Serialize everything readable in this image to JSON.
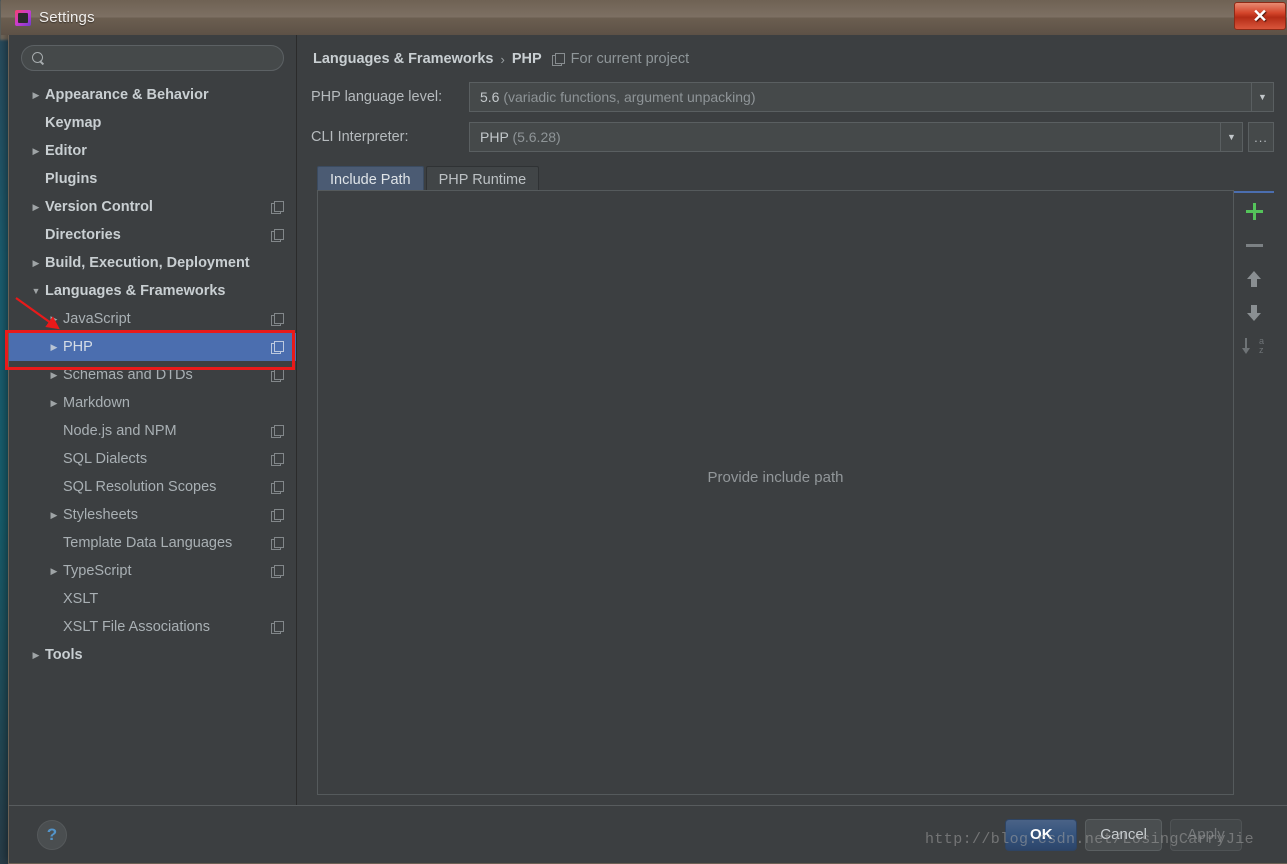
{
  "window": {
    "title": "Settings",
    "app_icon": "phpstorm-icon",
    "close_label": "✕"
  },
  "search": {
    "value": "",
    "placeholder": "",
    "icon": "search-icon"
  },
  "sidebar": {
    "items": [
      {
        "label": "Appearance & Behavior",
        "level": 0,
        "arrow": "▶",
        "badge": false,
        "selected": false
      },
      {
        "label": "Keymap",
        "level": 0,
        "arrow": "",
        "badge": false,
        "selected": false
      },
      {
        "label": "Editor",
        "level": 0,
        "arrow": "▶",
        "badge": false,
        "selected": false
      },
      {
        "label": "Plugins",
        "level": 0,
        "arrow": "",
        "badge": false,
        "selected": false
      },
      {
        "label": "Version Control",
        "level": 0,
        "arrow": "▶",
        "badge": true,
        "selected": false
      },
      {
        "label": "Directories",
        "level": 0,
        "arrow": "",
        "badge": true,
        "selected": false
      },
      {
        "label": "Build, Execution, Deployment",
        "level": 0,
        "arrow": "▶",
        "badge": false,
        "selected": false
      },
      {
        "label": "Languages & Frameworks",
        "level": 0,
        "arrow": "▼",
        "badge": false,
        "selected": false
      },
      {
        "label": "JavaScript",
        "level": 1,
        "arrow": "▶",
        "badge": true,
        "selected": false
      },
      {
        "label": "PHP",
        "level": 1,
        "arrow": "▶",
        "badge": true,
        "selected": true
      },
      {
        "label": "Schemas and DTDs",
        "level": 1,
        "arrow": "▶",
        "badge": true,
        "selected": false
      },
      {
        "label": "Markdown",
        "level": 1,
        "arrow": "▶",
        "badge": false,
        "selected": false
      },
      {
        "label": "Node.js and NPM",
        "level": 1,
        "arrow": "",
        "badge": true,
        "selected": false
      },
      {
        "label": "SQL Dialects",
        "level": 1,
        "arrow": "",
        "badge": true,
        "selected": false
      },
      {
        "label": "SQL Resolution Scopes",
        "level": 1,
        "arrow": "",
        "badge": true,
        "selected": false
      },
      {
        "label": "Stylesheets",
        "level": 1,
        "arrow": "▶",
        "badge": true,
        "selected": false
      },
      {
        "label": "Template Data Languages",
        "level": 1,
        "arrow": "",
        "badge": true,
        "selected": false
      },
      {
        "label": "TypeScript",
        "level": 1,
        "arrow": "▶",
        "badge": true,
        "selected": false
      },
      {
        "label": "XSLT",
        "level": 1,
        "arrow": "",
        "badge": false,
        "selected": false
      },
      {
        "label": "XSLT File Associations",
        "level": 1,
        "arrow": "",
        "badge": true,
        "selected": false
      },
      {
        "label": "Tools",
        "level": 0,
        "arrow": "▶",
        "badge": false,
        "selected": false
      }
    ]
  },
  "breadcrumb": {
    "parent": "Languages & Frameworks",
    "separator": "›",
    "current": "PHP",
    "scope_icon": "project-scope-icon",
    "scope_text": "For current project"
  },
  "fields": {
    "language_level": {
      "label": "PHP language level:",
      "value_main": "5.6 ",
      "value_dim": "(variadic functions, argument unpacking)",
      "arrow": "▼"
    },
    "cli_interpreter": {
      "label": "CLI Interpreter:",
      "value_main": "PHP ",
      "value_dim": "(5.6.28)",
      "arrow": "▼",
      "ellipsis_label": "..."
    }
  },
  "tabs": [
    {
      "label": "Include Path",
      "active": true
    },
    {
      "label": "PHP Runtime",
      "active": false
    }
  ],
  "panel": {
    "empty_text": "Provide include path",
    "toolbar": [
      {
        "name": "add-button",
        "icon": "plus-icon",
        "color": "#54c45a"
      },
      {
        "name": "remove-button",
        "icon": "minus-icon",
        "color": "#7c8184"
      },
      {
        "name": "move-up-button",
        "icon": "arrow-up-icon",
        "color": "#8a8f92"
      },
      {
        "name": "move-down-button",
        "icon": "arrow-down-icon",
        "color": "#8a8f92"
      },
      {
        "name": "sort-button",
        "icon": "sort-az-icon",
        "color": "#6e7376"
      }
    ],
    "sort_letters": {
      "a": "a",
      "z": "z"
    }
  },
  "footer": {
    "help_label": "?",
    "buttons": [
      {
        "label": "OK",
        "style": "primary"
      },
      {
        "label": "Cancel",
        "style": "normal"
      },
      {
        "label": "Apply",
        "style": "disabled"
      }
    ]
  },
  "watermark": "http://blog.csdn.net/LosingCarryJie",
  "colors": {
    "accent_selection": "#4b6eaf",
    "dialog_bg": "#3c3f41",
    "titlebar_bg": "#7d7063",
    "close_red": "#d4452b",
    "annotation_red": "#e81a1a",
    "add_green": "#54c45a",
    "help_blue": "#5394c9"
  }
}
